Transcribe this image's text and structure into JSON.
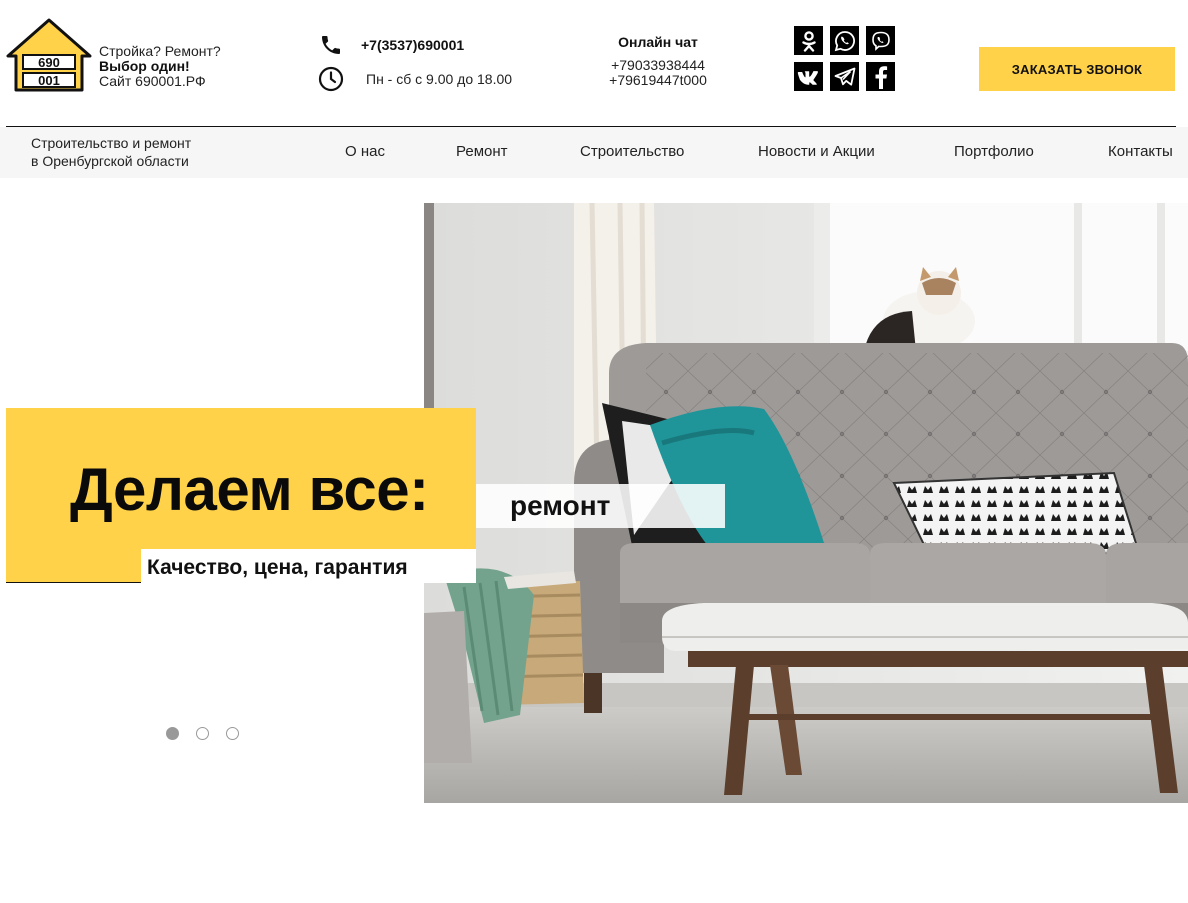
{
  "header": {
    "tagline": {
      "line1": "Стройка? Ремонт?",
      "line2": "Выбор один!",
      "line3": "Сайт 690001.РФ"
    },
    "logo_text": "690 001",
    "phone": "+7(3537)690001",
    "hours": "Пн - сб с 9.00 до 18.00",
    "chat": {
      "title": "Онлайн чат",
      "numbers": [
        "+79033938444",
        "+79619447t000"
      ]
    },
    "socials": [
      {
        "icon": "odnoklassniki-icon",
        "glyph": "ОК"
      },
      {
        "icon": "whatsapp-icon",
        "glyph": "✆"
      },
      {
        "icon": "viber-icon",
        "glyph": "☎"
      },
      {
        "icon": "vk-icon",
        "glyph": "vk"
      },
      {
        "icon": "telegram-icon",
        "glyph": "➤"
      },
      {
        "icon": "facebook-icon",
        "glyph": "f"
      }
    ],
    "callback_label": "ЗАКАЗАТЬ ЗВОНОК"
  },
  "nav": {
    "brand": {
      "line1": "Строительство и ремонт",
      "line2": "в Оренбургской области"
    },
    "items": [
      "О нас",
      "Ремонт",
      "Строительство",
      "Новости и Акции",
      "Портфолио",
      "Контакты"
    ]
  },
  "hero": {
    "headline": "Делаем все:",
    "rotating_word": "ремонт",
    "subheadline": "Качество, цена, гарантия",
    "slides_total": 3,
    "active_slide": 1
  },
  "colors": {
    "accent": "#ffd24a",
    "text": "#111111",
    "nav_bg": "#f6f6f6"
  }
}
